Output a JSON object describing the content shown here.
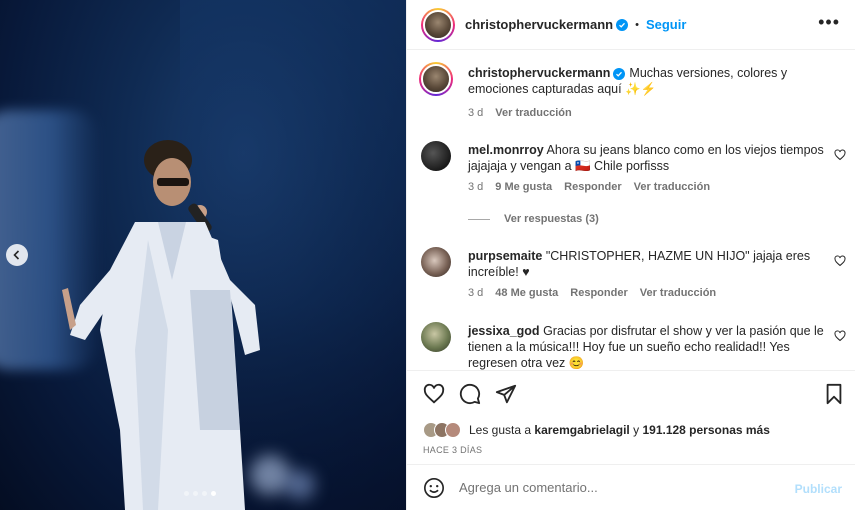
{
  "post": {
    "username": "christophervuckermann",
    "follow_label": "Seguir",
    "separator": "•",
    "more_label": "•••",
    "carousel": {
      "total_slides": 4,
      "active_slide": 4
    }
  },
  "caption": {
    "username": "christophervuckermann",
    "text": "Muchas versiones, colores y emociones capturadas aquí ✨⚡",
    "time": "3 d",
    "translate": "Ver traducción"
  },
  "comments": [
    {
      "username": "mel.monrroy",
      "text": "Ahora su jeans blanco como en los viejos tiempos jajajaja y vengan a 🇨🇱 Chile porfisss",
      "time": "3 d",
      "likes": "9 Me gusta",
      "reply": "Responder",
      "translate": "Ver traducción",
      "replies": "Ver respuestas (3)"
    },
    {
      "username": "purpsemaite",
      "text": "\"CHRISTOPHER, HAZME UN HIJO\" jajaja eres increíble! ♥",
      "time": "3 d",
      "likes": "48 Me gusta",
      "reply": "Responder",
      "translate": "Ver traducción"
    },
    {
      "username": "jessixa_god",
      "text": "Gracias por disfrutar el show y ver la pasión que le tienen a la música!!! Hoy fue un sueño echo realidad!! Yes regresen otra vez 😊"
    }
  ],
  "likes": {
    "prefix": "Les gusta a",
    "user": "karemgabrielagil",
    "middle": "y",
    "count": "191.128 personas más"
  },
  "ago": "HACE 3 DÍAS",
  "composer": {
    "placeholder": "Agrega un comentario...",
    "publish": "Publicar"
  },
  "colors": {
    "accent": "#0095f6",
    "publish_disabled": "#b2dffc",
    "secondary_text": "#737373"
  }
}
